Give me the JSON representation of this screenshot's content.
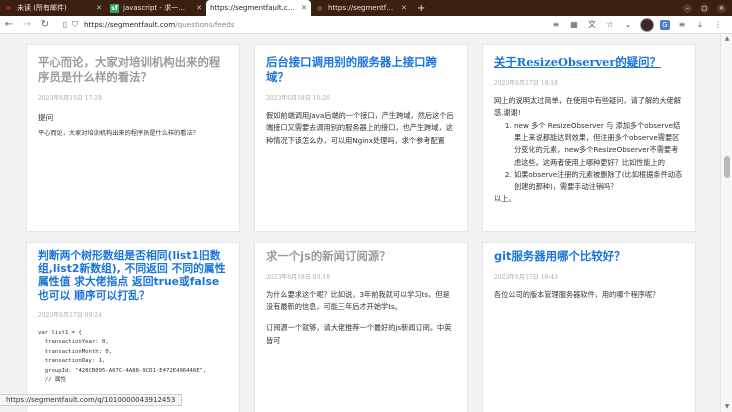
{
  "tabs": [
    {
      "label": "未读 (所有邮件)",
      "icon": "mail-icon"
    },
    {
      "label": "javascript - 求一个js的新...",
      "icon": "segmentfault-icon"
    },
    {
      "label": "https://segmentfault.com/",
      "icon": "globe-icon",
      "active": true
    },
    {
      "label": "https://segmentfault.co...",
      "icon": "globe-icon"
    }
  ],
  "toolbar": {
    "url_host": "https://segmentfault.com",
    "url_path": "/questions/feeds"
  },
  "cards": [
    {
      "title": "平心而论，大家对培训机构出来的程序员是什么样的看法？",
      "date": "2023年6月15日 17:28",
      "subtitle": "提问",
      "body": "平心而论，大家对培训机构出来的程序员是什么样的看法？"
    },
    {
      "title": "后台接口调用别的服务器上接口跨域？",
      "date": "2023年6月18日 10:26",
      "body": "假如前端调用Java后端的一个接口，产生跨域，然后这个后端接口又需要去调用别的服务器上的接口，也产生跨域，这种情况下该怎么办，可以用Nginx处理吗，求个参考配置"
    },
    {
      "title": "关于ResizeObserver的疑问？",
      "date": "2023年6月17日 18:18",
      "body": "网上的说明太过简单，在使用中有些疑问，请了解的大佬解惑.谢谢!",
      "list": [
        "new 多个 ResizeObserver 与 添加多个observe结果上来说都能达到效果，但注册多个observe需要区分变化的元素，new多个ResizeObserver不需要考虑这些。这两者使用上哪种更好？比如性能上的",
        "如果observe注册的元素被删除了(比如根据条件动态创建的那种)，需要手动注销吗？"
      ],
      "footer": "以上。"
    },
    {
      "title": "判断两个树形数组是否相同(list1旧数组,list2新数组), 不同返回 不同的属性属性值 求大佬指点 返回true或false也可以 顺序可以打乱？",
      "date": "2023年6月17日 09:24",
      "code": "var list1 = {\n  transactionYear: 0,\n  transactionMonth: 0,\n  transactionDay: 1,\n  groupId: \"428CB095-A67C-4A88-9CD1-E472E496446E\",\n  // 属性"
    },
    {
      "title": "求一个js的新闻订阅源？",
      "date": "2023年6月18日 03:18",
      "body": "为什么要求这个呢？比如说，3年前我就可以学习ts，但是没有最新的信息，可能三年后才开始学ts。",
      "body2": "订阅源一个就够，请大佬推荐一个最好的js新闻订阅。中英皆可"
    },
    {
      "title": "git服务器用哪个比较好？",
      "date": "2023年6月17日 16:43",
      "body": "各位公司的版本管理服务器软件，用的哪个程序呢？"
    }
  ],
  "status_url": "https://segmentfault.com/q/1010000043912453"
}
